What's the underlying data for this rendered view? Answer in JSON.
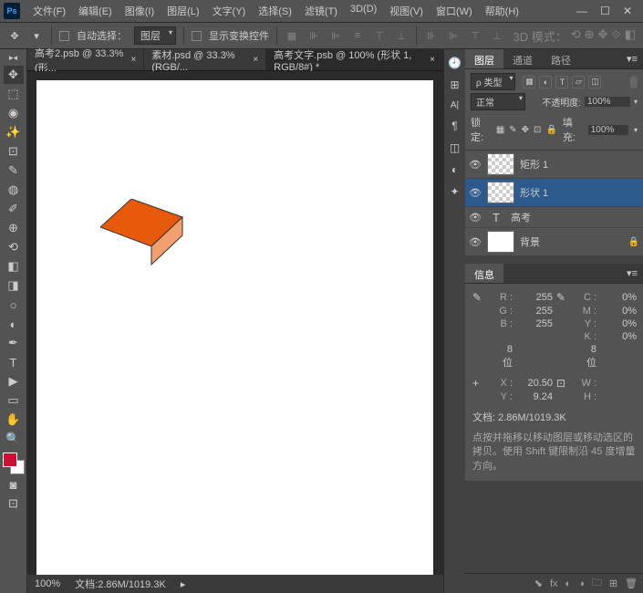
{
  "app": {
    "logo": "Ps"
  },
  "menu": {
    "file": "文件(F)",
    "edit": "编辑(E)",
    "image": "图像(I)",
    "layer": "图层(L)",
    "type": "文字(Y)",
    "select": "选择(S)",
    "filter": "滤镜(T)",
    "threed": "3D(D)",
    "view": "视图(V)",
    "window": "窗口(W)",
    "help": "帮助(H)"
  },
  "options": {
    "auto_select": "自动选择：",
    "auto_select_target": "图层",
    "show_transform": "显示变换控件",
    "mode_label": "3D 模式："
  },
  "tabs": [
    {
      "label": "高考2.psb @ 33.3% (形...",
      "active": false
    },
    {
      "label": "素材.psd @ 33.3%(RGB/...",
      "active": false
    },
    {
      "label": "高考文字.psb @ 100% (形状 1, RGB/8#) *",
      "active": true
    }
  ],
  "status": {
    "zoom": "100%",
    "doc": "文档:2.86M/1019.3K"
  },
  "layers_panel": {
    "tabs": {
      "layers": "图层",
      "channels": "通道",
      "paths": "路径"
    },
    "kind": "ρ 类型",
    "blend_mode": "正常",
    "opacity_label": "不透明度:",
    "opacity_value": "100%",
    "lock_label": "锁定:",
    "fill_label": "填充:",
    "fill_value": "100%",
    "items": [
      {
        "name": "矩形 1",
        "type": "shape"
      },
      {
        "name": "形状 1",
        "type": "shape",
        "selected": true
      },
      {
        "name": "高考",
        "type": "text"
      },
      {
        "name": "背景",
        "type": "bg",
        "locked": true
      }
    ]
  },
  "info_panel": {
    "tab": "信息",
    "rgb": {
      "R": "255",
      "G": "255",
      "B": "255"
    },
    "cmyk": {
      "C": "0%",
      "M": "0%",
      "Y": "0%",
      "K": "0%"
    },
    "bits1": "8 位",
    "bits2": "8 位",
    "pos": {
      "X": "20.50",
      "Y": "9.24"
    },
    "size": {
      "W": "",
      "H": ""
    },
    "doc_label": "文档:",
    "doc_value": "2.86M/1019.3K",
    "tip": "点按并拖移以移动图层或移动选区的拷贝。使用 Shift 键限制沿 45 度增量方向。"
  }
}
